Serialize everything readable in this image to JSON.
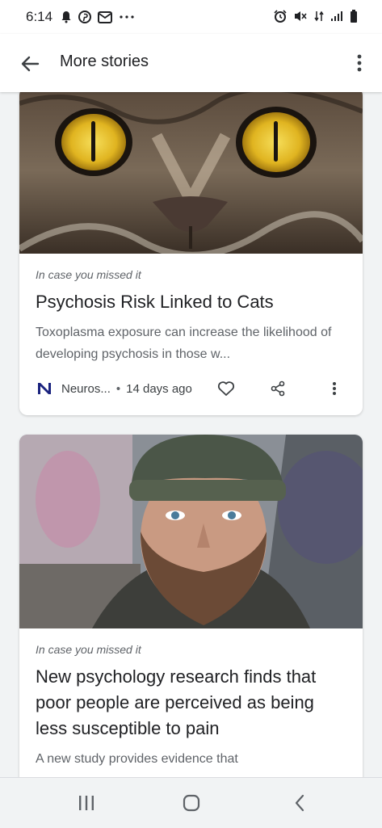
{
  "status_bar": {
    "time": "6:14",
    "left_icons": [
      "alarm-bell-icon",
      "pinterest-icon",
      "mail-icon",
      "more-notifications-icon"
    ],
    "right_icons": [
      "alarm-clock-icon",
      "mute-icon",
      "data-icon",
      "signal-icon",
      "battery-icon"
    ]
  },
  "app_bar": {
    "title": "More stories",
    "back_icon": "arrow-left-icon",
    "menu_icon": "more-vert-icon"
  },
  "cards": [
    {
      "kicker": "In case you missed it",
      "headline": "Psychosis Risk Linked to Cats",
      "snippet": "Toxoplasma exposure can increase the likelihood of developing psychosis in those w...",
      "source": "Neuros...",
      "separator": "•",
      "time_ago": "14 days ago",
      "image": "cat-eyes-closeup-image"
    },
    {
      "kicker": "In case you missed it",
      "headline": "New psychology research finds that poor people are perceived as being less susceptible to pain",
      "snippet": "A new study provides evidence that",
      "image": "bearded-man-beanie-image"
    }
  ],
  "nav_bar": {
    "icons": [
      "recents-icon",
      "home-icon",
      "back-icon"
    ]
  },
  "colors": {
    "background": "#f1f3f4",
    "card": "#ffffff",
    "text_primary": "#202124",
    "text_secondary": "#5f6368"
  }
}
